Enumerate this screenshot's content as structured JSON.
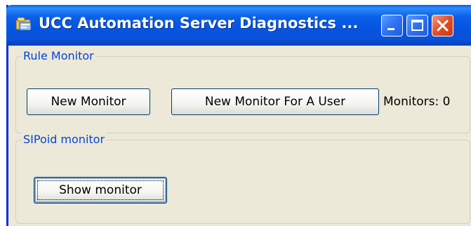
{
  "window": {
    "title": "UCC Automation Server Diagnostics ...",
    "icon": "app-icon",
    "controls": {
      "minimize_icon": "minimize-icon",
      "maximize_icon": "maximize-icon",
      "close_icon": "close-icon"
    }
  },
  "rule_monitor": {
    "legend": "Rule Monitor",
    "new_monitor_label": "New Monitor",
    "new_monitor_user_label": "New Monitor For A User",
    "monitors_count": "Monitors: 0"
  },
  "sipoid_monitor": {
    "legend": "SIPoid monitor",
    "show_monitor_label": "Show monitor"
  },
  "colors": {
    "titlebar": "#0a5fe8",
    "window_bg": "#ece9d8",
    "legend_text": "#0046d5",
    "close_button": "#e24d24"
  }
}
